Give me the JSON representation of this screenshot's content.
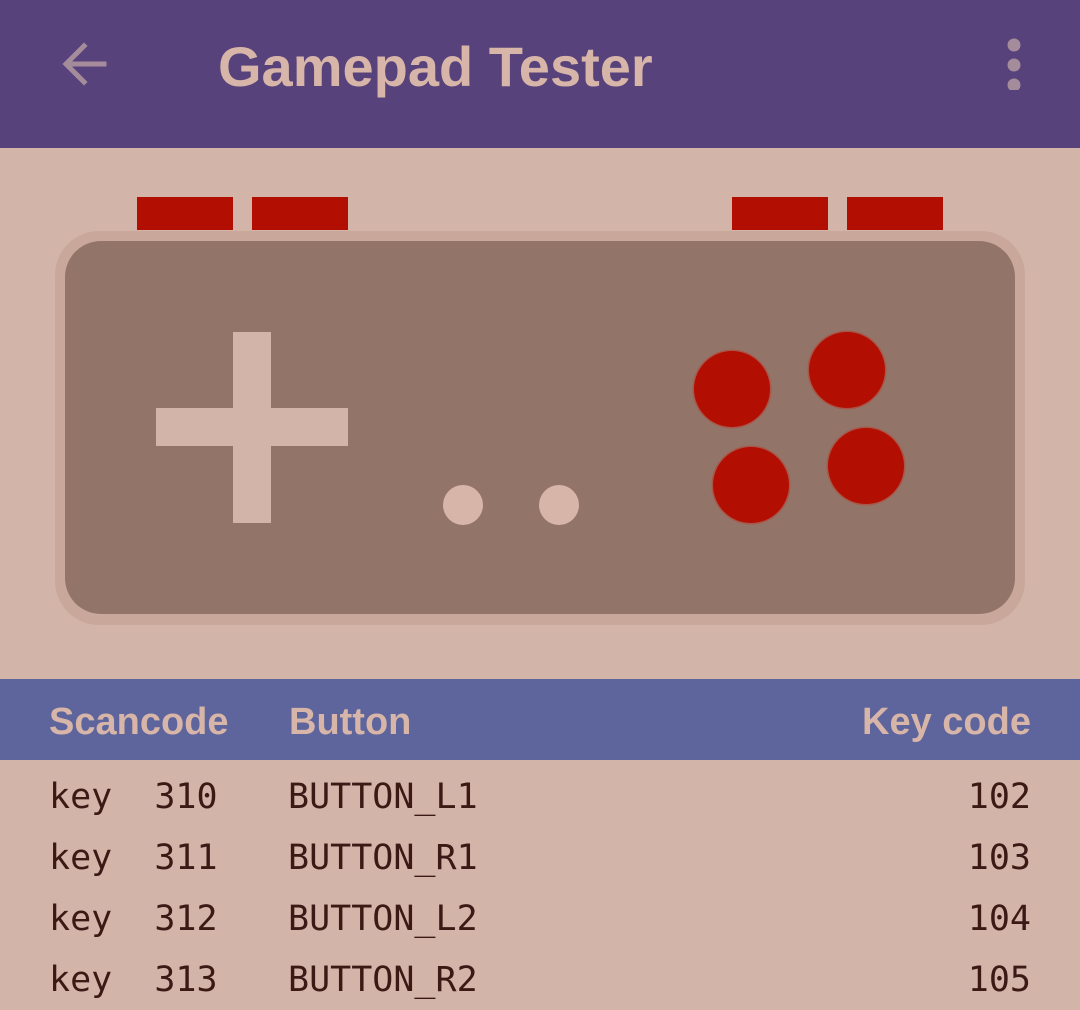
{
  "app_bar": {
    "title": "Gamepad Tester",
    "back_icon": "arrow-left-icon",
    "menu_icon": "more-vert-icon"
  },
  "colors": {
    "app_bar": "#57427b",
    "background": "#d3b4a9",
    "pad_body": "#937469",
    "button_active": "#b20e02",
    "table_header": "#5e649c",
    "text_light": "#d7b5a8",
    "text_dark": "#3b1a15"
  },
  "gamepad": {
    "shoulder_buttons": [
      "L2",
      "L1",
      "R1",
      "R2"
    ],
    "face_buttons": [
      "Y",
      "X",
      "B",
      "A"
    ],
    "center_buttons": [
      "select",
      "start"
    ]
  },
  "table": {
    "headers": {
      "scancode": "Scancode",
      "button": "Button",
      "keycode": "Key code"
    },
    "rows": [
      {
        "scancode": "key  310",
        "button": "BUTTON_L1",
        "keycode": "102"
      },
      {
        "scancode": "key  311",
        "button": "BUTTON_R1",
        "keycode": "103"
      },
      {
        "scancode": "key  312",
        "button": "BUTTON_L2",
        "keycode": "104"
      },
      {
        "scancode": "key  313",
        "button": "BUTTON_R2",
        "keycode": "105"
      }
    ]
  }
}
